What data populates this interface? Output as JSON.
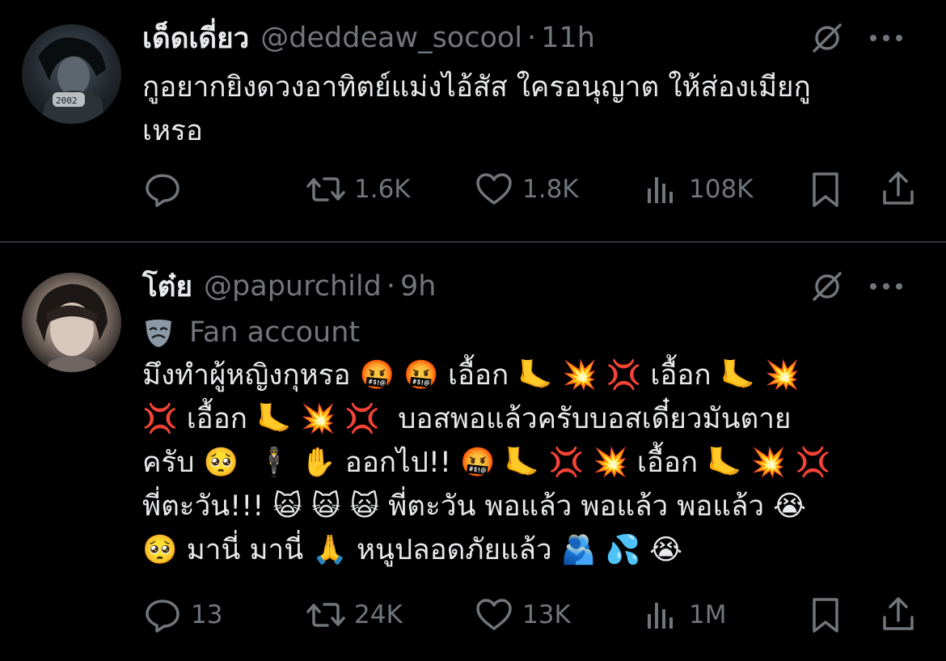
{
  "tweets": [
    {
      "name": "เด็ดเดี่ยว",
      "handle": "@deddeaw_socool",
      "separator": "·",
      "time": "11h",
      "text": "กูอยากยิงดวงอาทิตย์แม่งไอ้สัส ใครอนุญาต ให้ส่องเมียกู\nเหรอ",
      "replies": "",
      "retweets": "1.6K",
      "likes": "1.8K",
      "views": "108K"
    },
    {
      "name": "โต๋ย",
      "handle": "@papurchild",
      "separator": "·",
      "time": "9h",
      "badge": "Fan account",
      "text": "มึงทำผู้หญิงกุหรอ 🤬 🤬 เอื้อก 🦶 💥 💢 เอื้อก 🦶 💥\n💢 เอื้อก 🦶 💥 💢  บอสพอแล้วครับบอสเดี๋ยวมันตาย\nครับ 🥺  🕴 ✋ ออกไป!! 🤬 🦶 💢 💥 เอื้อก 🦶 💥 💢\nพี่ตะวัน!!! 🙀 🙀 🙀 พี่ตะวัน พอแล้ว พอแล้ว พอแล้ว 😭\n🥺 มานี่ มานี่ 🙏 หนูปลอดภัยแล้ว 🫂 💦 😭",
      "replies": "13",
      "retweets": "24K",
      "likes": "13K",
      "views": "1M"
    }
  ],
  "icons": {
    "reply": "speech-bubble-icon",
    "retweet": "retweet-arrows-icon",
    "like": "heart-outline-icon",
    "views": "bar-chart-icon",
    "bookmark": "bookmark-icon",
    "share": "share-upload-icon",
    "grok": "grok-slash-circle-icon",
    "more": "ellipsis-icon",
    "badge": "theater-mask-icon"
  },
  "colors": {
    "background": "#000000",
    "text": "#e7e9ea",
    "muted": "#71767b",
    "divider": "#2f3336"
  }
}
